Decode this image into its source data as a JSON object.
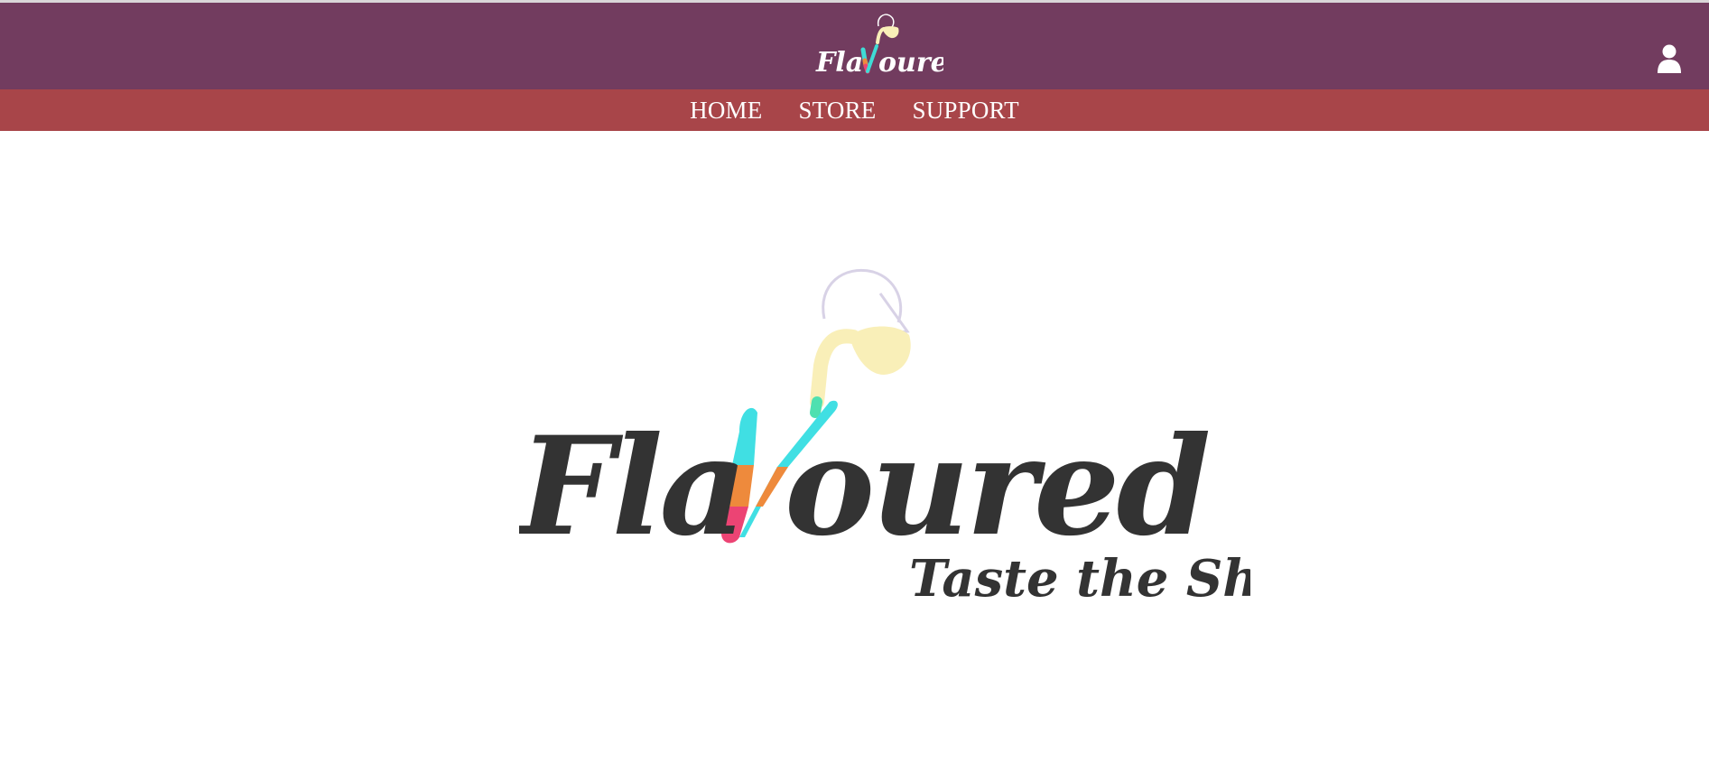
{
  "brand": {
    "name_left": "Fla",
    "name_v": "V",
    "name_right": "oured",
    "tagline": "Taste the Shades"
  },
  "nav": {
    "items": [
      {
        "label": "HOME"
      },
      {
        "label": "STORE"
      },
      {
        "label": "SUPPORT"
      }
    ]
  },
  "icons": {
    "account": "user-icon",
    "logo_pitcher": "pitcher-icon"
  },
  "colors": {
    "header_bg": "#723c5f",
    "nav_bg": "#a84549",
    "logo_text": "#333333",
    "v_teal": "#3fdcd6",
    "v_orange": "#ee8a3c",
    "v_pink": "#ec4474",
    "pour_yellow": "#f9efb8"
  }
}
